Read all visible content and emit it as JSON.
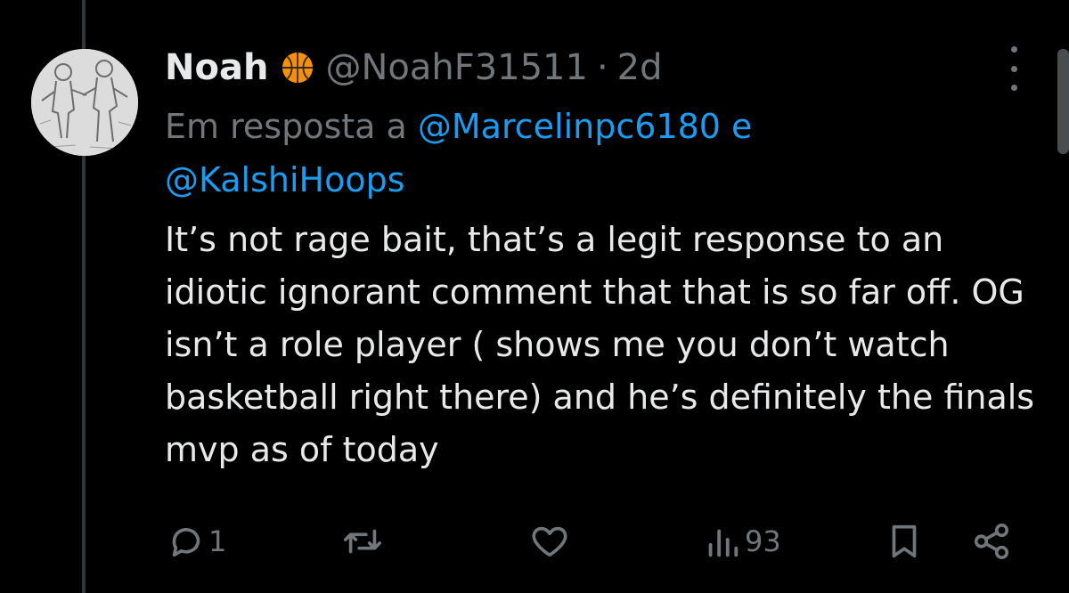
{
  "tweet": {
    "author_name": "Noah",
    "author_emoji": "basketball-emoji",
    "handle": "@NoahF31511",
    "separator": "·",
    "time": "2d",
    "reply_prefix": "Em resposta a",
    "mention_1": "@Marcelinpc6180",
    "reply_conjunction": "e",
    "mention_2": "@KalshiHoops",
    "text": "It’s not rage bait, that’s a legit response to an idiotic ignorant comment that that is so far off. OG isn’t a role player ( shows me you don’t watch basketball right there) and he’s definitely the finals mvp as of today"
  },
  "actions": {
    "reply_count": "1",
    "retweet_count": "",
    "like_count": "",
    "views_count": "93"
  },
  "icons": {
    "reply": "reply-icon",
    "retweet": "retweet-icon",
    "like": "heart-icon",
    "views": "views-icon",
    "bookmark": "bookmark-icon",
    "share": "share-icon",
    "more": "more-options-icon"
  },
  "colors": {
    "background": "#000000",
    "text": "#e7e9ea",
    "muted": "#71767b",
    "mention": "#1d9bf0",
    "thread_line": "#333639",
    "basketball": "#f4900c"
  }
}
